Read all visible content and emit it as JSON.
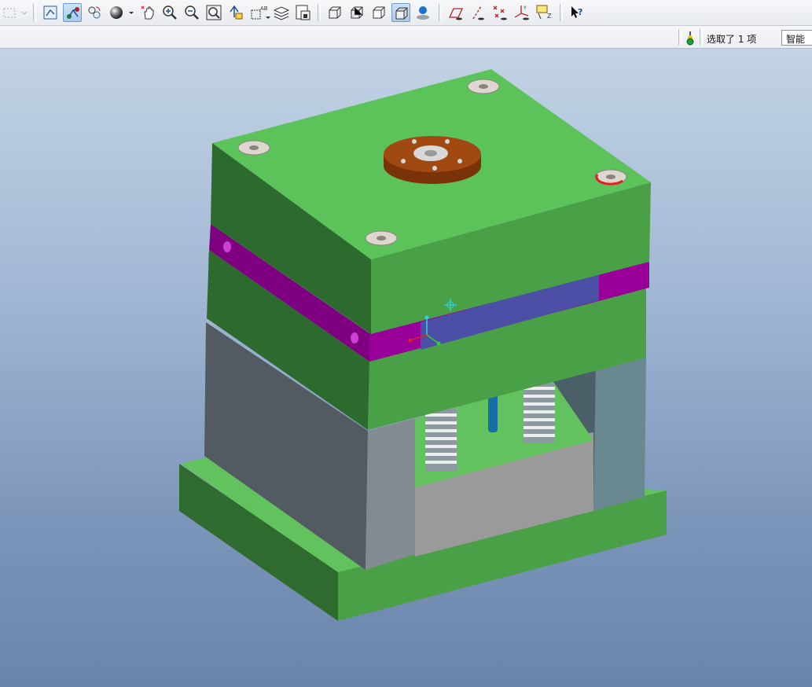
{
  "toolbar": {
    "icons": [
      "select-box-icon",
      "redraw-icon",
      "spin-center-icon",
      "orient-mode-icon",
      "sphere-shading-icon",
      "pan-icon",
      "zoom-in-icon",
      "zoom-out-icon",
      "refit-icon",
      "reorient-icon",
      "saved-views-icon",
      "layers-icon",
      "model-tree-icon",
      "wireframe-icon",
      "hidden-line-icon",
      "no-hidden-icon",
      "shading-icon",
      "enhanced-realism-icon",
      "datum-planes-icon",
      "datum-axes-icon",
      "datum-points-icon",
      "coordinate-systems-icon",
      "annotations-icon",
      "context-help-icon"
    ]
  },
  "statusbar": {
    "selection_text": "选取了 1 项",
    "filter_value": "智能",
    "traffic_light_icon": "traffic-light-icon"
  },
  "viewport": {
    "background_top": "#c3d3e5",
    "background_bottom": "#6a84ab",
    "plate_green": "#5cc35a",
    "plate_purple": "#990099",
    "ejector_gray": "#8a9299",
    "sprue_bushing_brown": "#a04a12",
    "highlight_blue": "#4b4fa6"
  }
}
